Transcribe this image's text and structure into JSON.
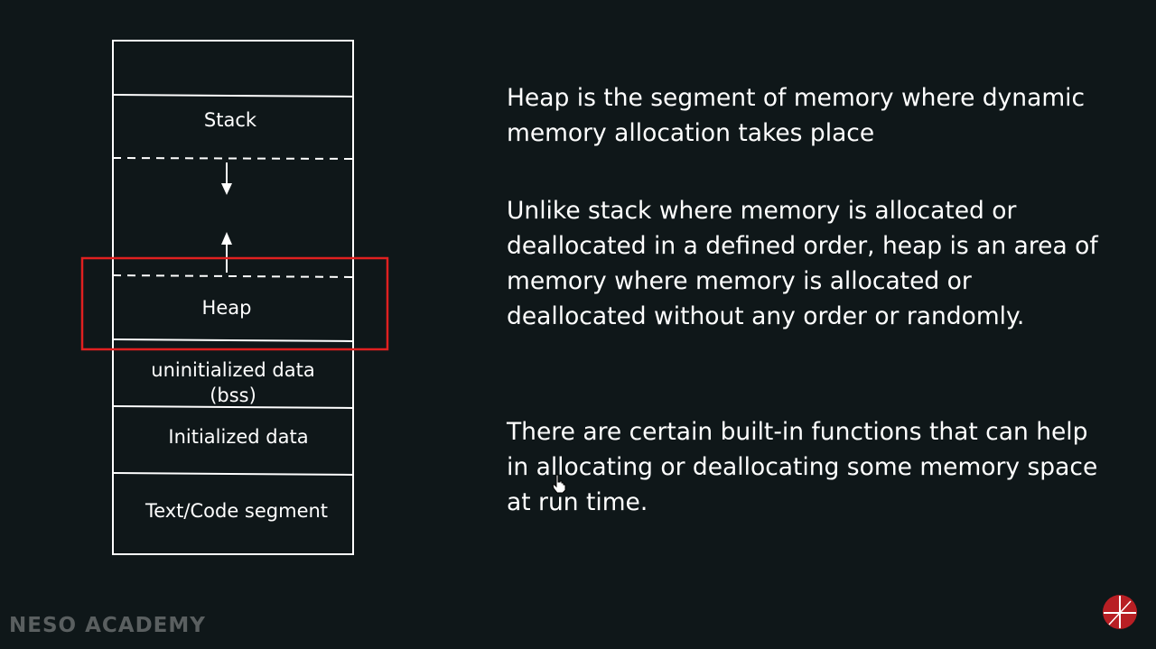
{
  "segments": {
    "stack": "Stack",
    "heap": "Heap",
    "bss_line1": "uninitialized data",
    "bss_line2": "(bss)",
    "initialized": "Initialized data",
    "text": "Text/Code segment"
  },
  "paragraphs": {
    "p1": "Heap is the segment of memory where dynamic memory allocation takes place",
    "p2": "Unlike stack where memory is allocated or deallocated in a defined order, heap is an area of memory where memory is allocated or deallocated without any order or randomly.",
    "p3": "There are certain built-in functions that can help in allocating or deallocating some memory space at run time."
  },
  "brand": "NESO ACADEMY",
  "colors": {
    "background": "#0f1719",
    "highlight": "#e02020",
    "text": "#ffffff",
    "brand": "#5a5f60"
  },
  "icons": {
    "logo": "neso-academy-logo-icon",
    "cursor": "hand-cursor-icon"
  }
}
